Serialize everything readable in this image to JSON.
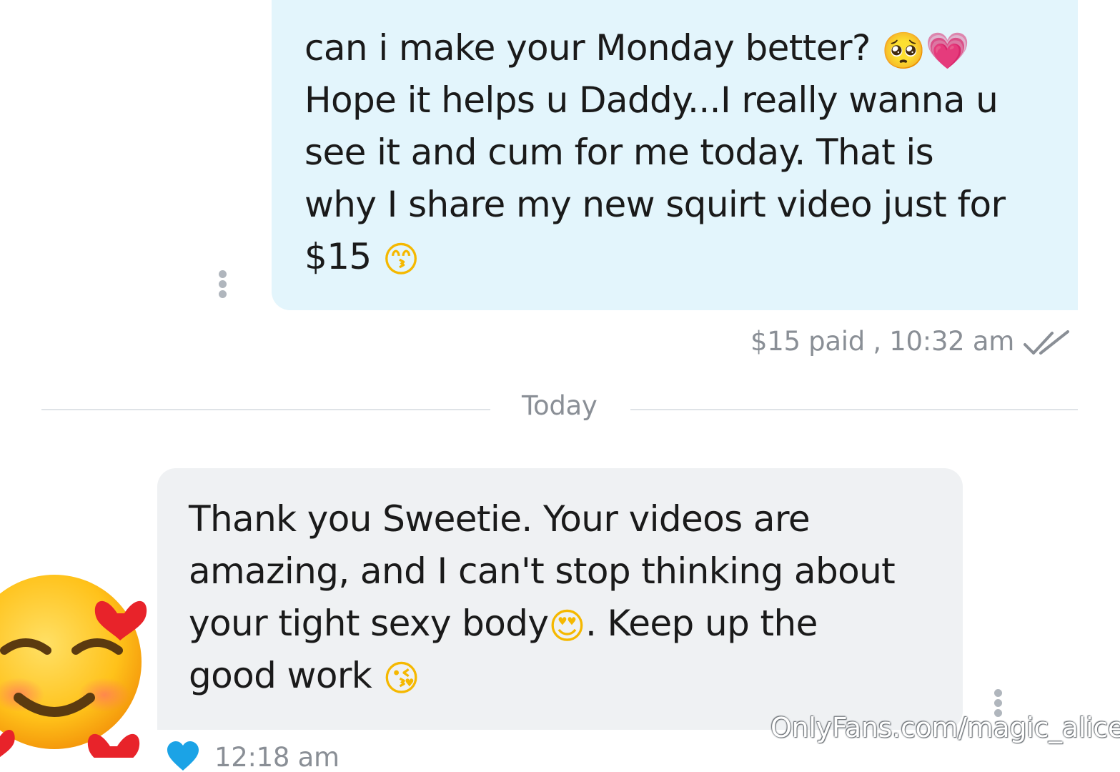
{
  "outgoing_message": {
    "line1_text": "can i make your Monday better? ",
    "line1_emoji_a": "🥺",
    "line1_emoji_b": "💗",
    "line2": "Hope it helps u Daddy...I really wanna u",
    "line3": "see it and cum for me today. That is",
    "line4": "why I share my new squirt video just for",
    "line5_text": "$15 ",
    "line5_emoji": "😙",
    "meta": "$15 paid , 10:32 am",
    "status_icon": "double-check-icon"
  },
  "divider": {
    "label": "Today"
  },
  "incoming_message": {
    "line1": "Thank you Sweetie. Your videos are",
    "line2": "amazing, and I can't stop thinking about",
    "line3_text_a": "your tight sexy body",
    "line3_emoji": "😍",
    "line3_text_b": ". Keep up the",
    "line4_text": "good work ",
    "line4_emoji": "😘",
    "time": "12:18 am",
    "liked_icon": "heart-icon"
  },
  "avatar": {
    "emoji": "🥰",
    "icon": "smiling-face-with-hearts-icon"
  },
  "watermark": {
    "text": "OnlyFans.com/magic_alice"
  },
  "colors": {
    "outgoing_bubble": "#e3f5fc",
    "incoming_bubble": "#eff1f3",
    "meta_text": "#8a8f96",
    "like_heart": "#1ba3e6"
  }
}
